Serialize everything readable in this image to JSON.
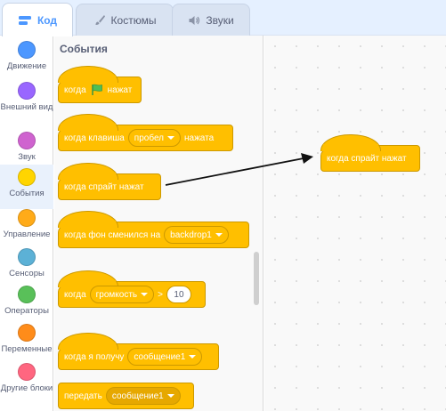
{
  "tabs": {
    "code": "Код",
    "costumes": "Костюмы",
    "sounds": "Звуки"
  },
  "categories": [
    {
      "label": "Движение",
      "color": "#4c97ff"
    },
    {
      "label": "Внешний вид",
      "color": "#9966ff"
    },
    {
      "label": "Звук",
      "color": "#cf63cf"
    },
    {
      "label": "События",
      "color": "#ffd500",
      "selected": true
    },
    {
      "label": "Управление",
      "color": "#ffab19"
    },
    {
      "label": "Сенсоры",
      "color": "#5cb1d6"
    },
    {
      "label": "Операторы",
      "color": "#59c059"
    },
    {
      "label": "Переменные",
      "color": "#ff8c1a"
    },
    {
      "label": "Другие блоки",
      "color": "#ff6680"
    }
  ],
  "palette": {
    "title": "События",
    "blocks": {
      "flag_clicked": {
        "before": "когда",
        "after": "нажат"
      },
      "key_pressed": {
        "before": "когда клавиша",
        "dropdown": "пробел",
        "after": "нажата"
      },
      "sprite_clicked": {
        "text": "когда спрайт нажат"
      },
      "backdrop_switched": {
        "before": "когда фон сменился на",
        "dropdown": "backdrop1"
      },
      "greater_than": {
        "before": "когда",
        "dropdown": "громкость",
        "operator": ">",
        "value": "10"
      },
      "receive": {
        "before": "когда я получу",
        "dropdown": "сообщение1"
      },
      "broadcast": {
        "before": "передать",
        "dropdown": "сообщение1"
      }
    }
  },
  "script": {
    "block_text": "когда спрайт нажат"
  },
  "colors": {
    "events": "#ffbf00",
    "events_border": "#cc9900",
    "accent": "#4c97ff"
  }
}
